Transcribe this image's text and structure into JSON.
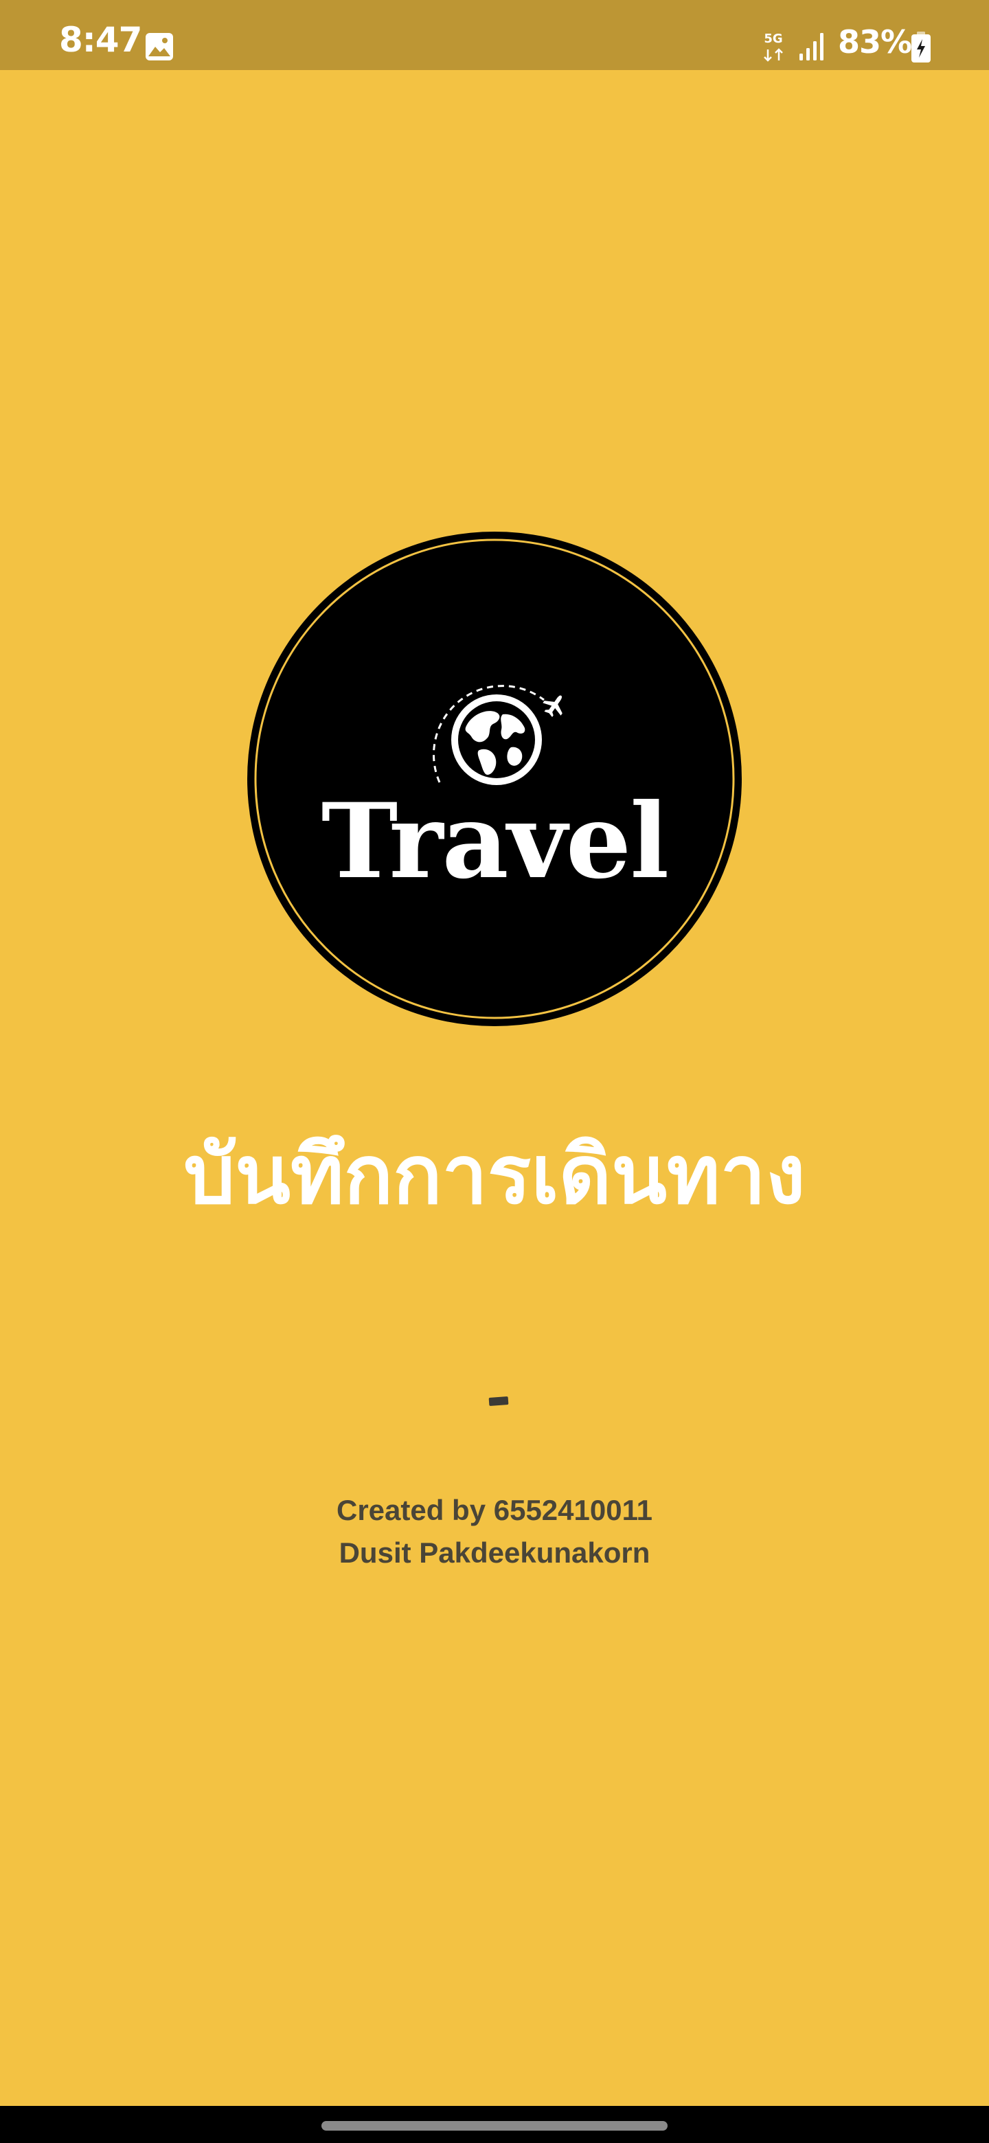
{
  "status_bar": {
    "time": "8:47",
    "network_label": "5G",
    "battery_percent": "83%",
    "icons": [
      "gallery-icon",
      "network-5g-icon",
      "signal-icon",
      "battery-charging-icon"
    ]
  },
  "logo": {
    "wordmark": "Travel",
    "icons": [
      "globe-icon",
      "airplane-icon"
    ]
  },
  "app_title": "บันทึกการเดินทาง",
  "credits": {
    "line1": "Created by 6552410011",
    "line2": "Dusit Pakdeekunakorn"
  },
  "colors": {
    "background": "#F3C243",
    "status_bar": "#BD9634",
    "logo_circle": "#000000",
    "logo_ring": "#F3C243",
    "title_text": "#FFFFFF",
    "credits_text": "#4A4537"
  }
}
